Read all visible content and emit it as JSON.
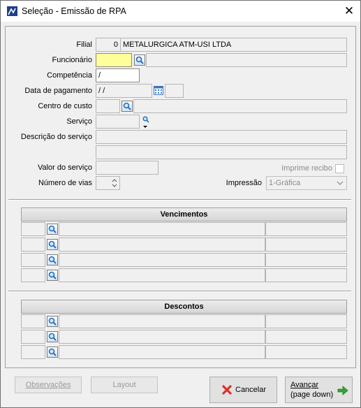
{
  "window": {
    "title": "Seleção - Emissão de RPA",
    "close_glyph": "✕",
    "icon": "app-logo-icon"
  },
  "form": {
    "filial": {
      "label": "Filial",
      "code": "0",
      "name": "METALURGICA ATM-USI LTDA"
    },
    "funcionario": {
      "label": "Funcionário",
      "value": "",
      "description": ""
    },
    "competencia": {
      "label": "Competência",
      "value": "/"
    },
    "data_pagamento": {
      "label": "Data de pagamento",
      "value": " /  /",
      "extra": ""
    },
    "centro_custo": {
      "label": "Centro de custo",
      "value": "",
      "description": ""
    },
    "servico": {
      "label": "Serviço",
      "value": ""
    },
    "descricao_servico": {
      "label": "Descrição do serviço",
      "line1": "",
      "line2": ""
    },
    "valor_servico": {
      "label": "Valor do serviço",
      "value": ""
    },
    "imprime_recibo": {
      "label": "Imprime recibo",
      "checked": false
    },
    "numero_vias": {
      "label": "Número de vias",
      "value": ""
    },
    "impressao": {
      "label": "Impressão",
      "selected": "1-Gráfica"
    }
  },
  "vencimentos": {
    "header": "Vencimentos",
    "rows": [
      {
        "code": "",
        "description": "",
        "value": ""
      },
      {
        "code": "",
        "description": "",
        "value": ""
      },
      {
        "code": "",
        "description": "",
        "value": ""
      },
      {
        "code": "",
        "description": "",
        "value": ""
      }
    ]
  },
  "descontos": {
    "header": "Descontos",
    "rows": [
      {
        "code": "",
        "description": "",
        "value": ""
      },
      {
        "code": "",
        "description": "",
        "value": ""
      },
      {
        "code": "",
        "description": "",
        "value": ""
      }
    ]
  },
  "buttons": {
    "observacoes": "Observações",
    "layout": "Layout",
    "cancelar": "Cancelar",
    "avancar_line1": "Avançar",
    "avancar_line2": "(page down)"
  },
  "colors": {
    "focused_field": "#ffff99",
    "cancel_icon": "#d9302c",
    "advance_icon": "#2fa82f",
    "lookup_icon": "#1f6fbf"
  }
}
